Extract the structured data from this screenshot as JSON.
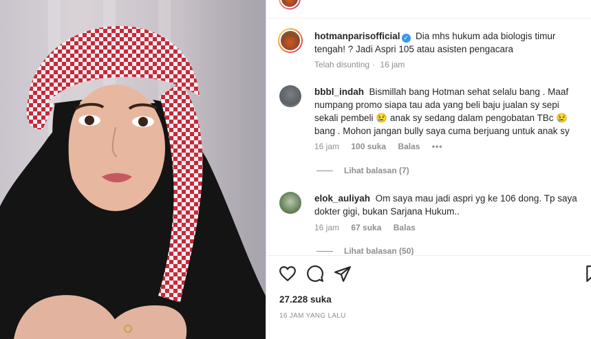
{
  "post": {
    "author": "hotmanparisofficial",
    "caption": "Dia mhs hukum ada biologis timur tengah! ? Jadi Aspri 105 atau asisten pengacara",
    "edited": "Telah disunting",
    "time": "16 jam"
  },
  "comments": [
    {
      "user": "bbbl_indah",
      "text": "Bismillah bang Hotman sehat selalu bang . Maaf numpang promo siapa tau ada yang beli baju jualan sy sepi sekali pembeli 😢 anak sy sedang dalam pengobatan TBc 😢 bang . Mohon jangan bully saya cuma berjuang untuk anak sy",
      "time": "16 jam",
      "likes": "100 suka",
      "reply": "Balas",
      "more": "•••",
      "view_replies": "Lihat balasan (7)"
    },
    {
      "user": "elok_auliyah",
      "text": "Om saya mau jadi aspri yg ke 106 dong. Tp saya dokter gigi, bukan Sarjana Hukum..",
      "time": "16 jam",
      "likes": "67 suka",
      "reply": "Balas",
      "view_replies": "Lihat balasan (50)"
    }
  ],
  "footer": {
    "likes": "27.228 suka",
    "time_ago": "16 JAM YANG LALU"
  },
  "icons": {
    "like": "heart-icon",
    "comment": "comment-icon",
    "share": "share-icon",
    "save": "bookmark-icon"
  }
}
